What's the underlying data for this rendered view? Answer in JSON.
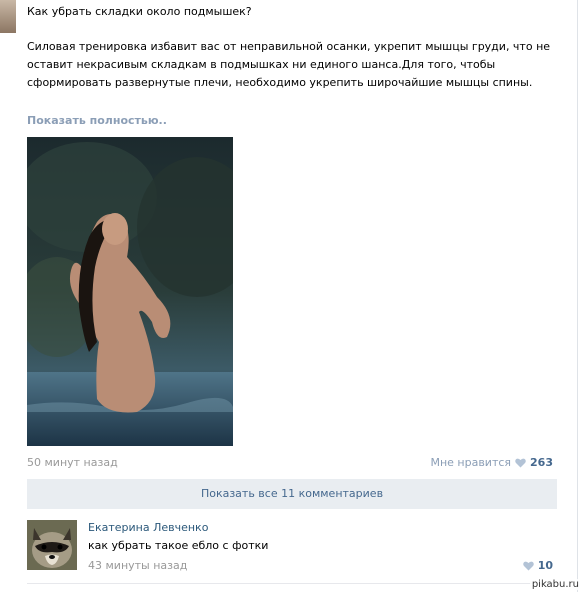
{
  "post": {
    "title": "Как убрать складки около подмышек?",
    "body": "Силовая тренировка избавит вас от неправильной осанки, укрепит мышцы груди, что не оставит некрасивым складкам в подмышках ни единого шанса.Для того, чтобы сформировать развернутые плечи, необходимо укрепить широчайшие мышцы спины.",
    "show_full_label": "Показать полностью..",
    "time": "50 минут назад",
    "like_label": "Мне нравится",
    "like_count": "263"
  },
  "comments": {
    "show_all_label": "Показать все 11 комментариев",
    "items": [
      {
        "author": "Екатерина Левченко",
        "text": "как убрать такое ебло с фотки",
        "time": "43 минуты назад",
        "like_count": "10"
      }
    ]
  },
  "watermark": "pikabu.ru",
  "colors": {
    "link": "#2b587a",
    "muted": "#999999",
    "accent": "#45688e",
    "button_bg": "#e9edf1"
  },
  "icons": {
    "like": "heart-icon"
  }
}
